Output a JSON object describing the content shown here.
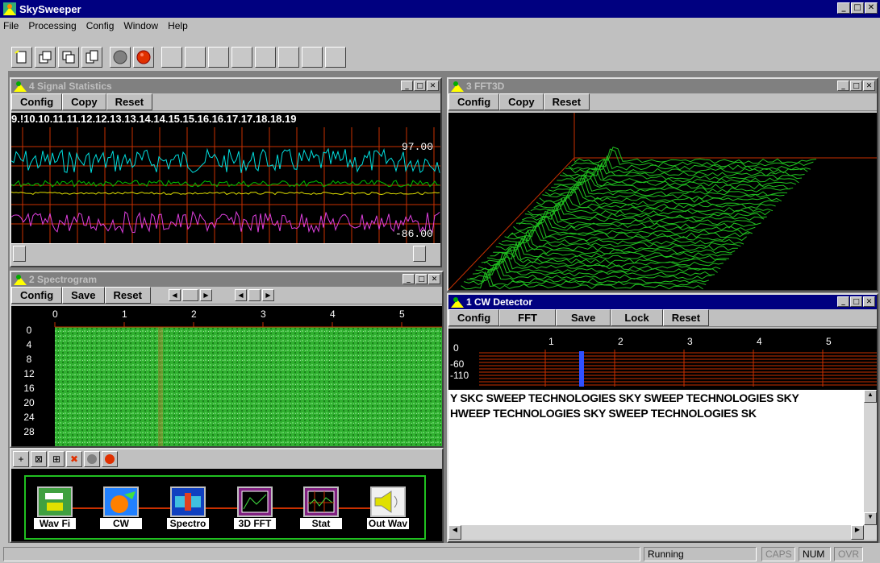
{
  "app": {
    "title": "SkySweeper"
  },
  "menu": [
    "File",
    "Processing",
    "Config",
    "Window",
    "Help"
  ],
  "windows": {
    "stats": {
      "title": "4 Signal Statistics",
      "buttons": [
        "Config",
        "Copy",
        "Reset"
      ],
      "axis": "9.!10.10.11.11.12.12.13.13.14.14.15.15.16.16.17.17.18.18.19",
      "max": "97.00",
      "min": "-86.00"
    },
    "fft3d": {
      "title": "3 FFT3D",
      "buttons": [
        "Config",
        "Copy",
        "Reset"
      ]
    },
    "spectrogram": {
      "title": "2 Spectrogram",
      "buttons": [
        "Config",
        "Save",
        "Reset"
      ],
      "xticks": [
        "0",
        "1",
        "2",
        "3",
        "4",
        "5"
      ],
      "yticks": [
        "0",
        "4",
        "8",
        "12",
        "16",
        "20",
        "24",
        "28"
      ]
    },
    "cw": {
      "title": "1 CW Detector",
      "buttons": [
        "Config",
        "FFT",
        "Save",
        "Lock",
        "Reset"
      ],
      "xticks": [
        "0",
        "1",
        "2",
        "3",
        "4",
        "5"
      ],
      "ylabels": [
        "-60",
        "-110"
      ],
      "line1": "Y SKC SWEEP TECHNOLOGIES SKY SWEEP TECHNOLOGIES SKY",
      "line2": "HWEEP TECHNOLOGIES SKY SWEEP TECHNOLOGIES SK"
    },
    "flow": {
      "modules": [
        "Wav Fi",
        "CW",
        "Spectro",
        "3D FFT",
        "Stat",
        "Out Wav"
      ]
    }
  },
  "status": {
    "state": "Running",
    "caps": "CAPS",
    "num": "NUM",
    "ovr": "OVR"
  },
  "colors": {
    "titlebar": "#000080",
    "plotGreen": "#00cc00",
    "gridRed": "#c83000",
    "cyan": "#00e0e0",
    "magenta": "#e040e0",
    "yellow": "#e0e000"
  }
}
